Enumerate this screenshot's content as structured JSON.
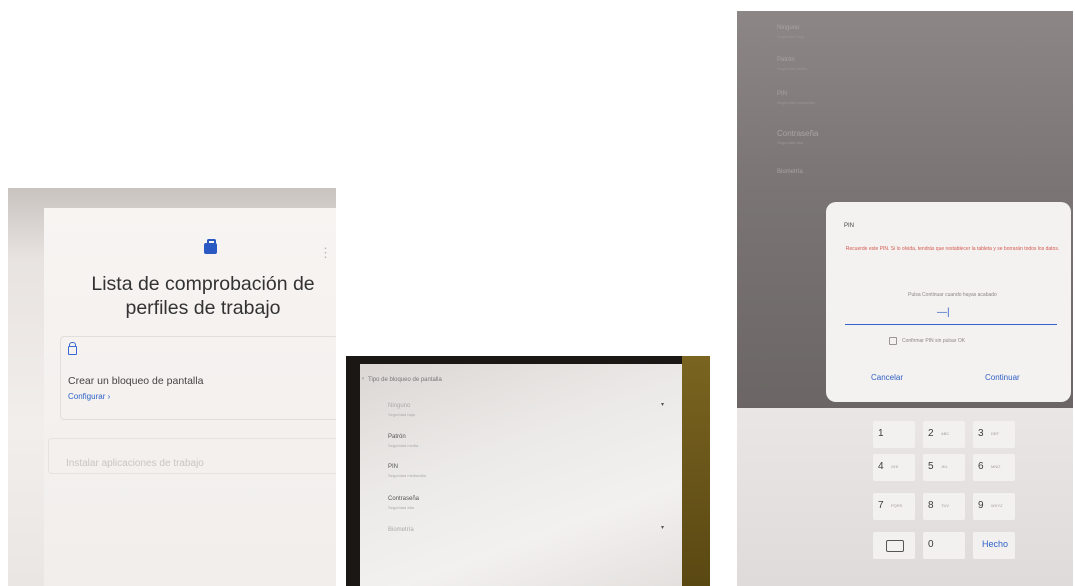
{
  "photo1": {
    "title": "Lista de comprobación de perfiles de trabajo",
    "item_title": "Crear un bloqueo de pantalla",
    "item_link": "Configurar  ›",
    "item2": "Instalar aplicaciones de trabajo",
    "more_icon": "⋮"
  },
  "photo2": {
    "header": "Tipo de bloqueo de pantalla",
    "back_icon": "‹",
    "rows": [
      {
        "label": "Ninguno",
        "sub": "Seguridad baja"
      },
      {
        "label": "Patrón",
        "sub": "Seguridad media"
      },
      {
        "label": "PIN",
        "sub": "Seguridad media/alta"
      },
      {
        "label": "Contraseña",
        "sub": "Seguridad alta"
      },
      {
        "label": "Biometría",
        "sub": ""
      }
    ]
  },
  "photo3": {
    "background_rows": [
      {
        "label": "Ninguno",
        "sub": "Seguridad baja"
      },
      {
        "label": "Patrón",
        "sub": "Seguridad media"
      },
      {
        "label": "PIN",
        "sub": "Seguridad media/alta"
      },
      {
        "label": "Contraseña",
        "sub": "Seguridad alta"
      },
      {
        "label": "Biometría",
        "sub": ""
      }
    ],
    "dialog": {
      "title": "PIN",
      "warning": "Recuerde este PIN. Si lo olvida, tendrás que restablecer la tableta y se borrarán todos los datos.",
      "hint": "Pulsa Continuar cuando hayas acabado",
      "pin_mask": "—|",
      "checkbox_label": "Confirmar PIN sin pulsar OK",
      "cancel": "Cancelar",
      "continue": "Continuar"
    },
    "keypad": [
      {
        "num": "1",
        "letters": ""
      },
      {
        "num": "2",
        "letters": "ABC"
      },
      {
        "num": "3",
        "letters": "DEF"
      },
      {
        "num": "4",
        "letters": "GHI"
      },
      {
        "num": "5",
        "letters": "JKL"
      },
      {
        "num": "6",
        "letters": "MNO"
      },
      {
        "num": "7",
        "letters": "PQRS"
      },
      {
        "num": "8",
        "letters": "TUV"
      },
      {
        "num": "9",
        "letters": "WXYZ"
      },
      {
        "num": "0",
        "letters": ""
      }
    ],
    "done": "Hecho",
    "backspace_icon": "backspace-icon"
  },
  "colors": {
    "accent_blue": "#2f62c8",
    "warning_red": "#d25a4f"
  }
}
